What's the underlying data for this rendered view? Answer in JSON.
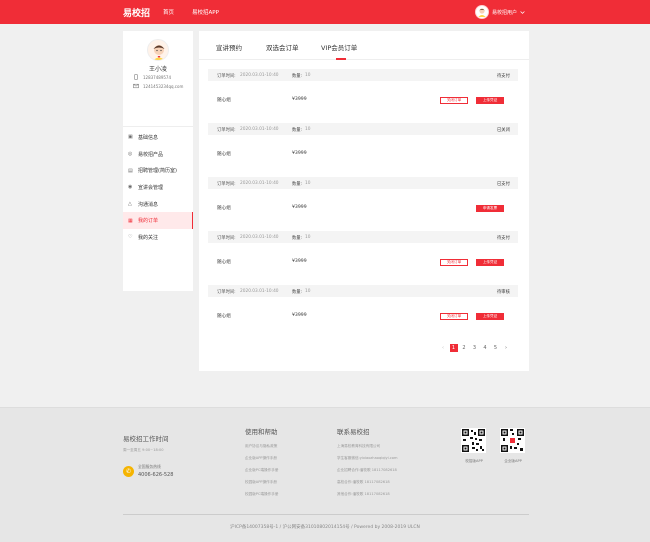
{
  "header": {
    "logo": "易校招",
    "nav": [
      "首页",
      "易校招APP"
    ],
    "user_name": "易校招用户",
    "user_chevron": "chevron-down-icon"
  },
  "colors": {
    "brand": "#f02d37",
    "phone_icon": "#f5b400"
  },
  "profile": {
    "name": "王小凌",
    "phone": "12837489574",
    "email": "1241453234qq.com",
    "phone_icon": "phone-icon",
    "email_icon": "mail-icon"
  },
  "menu": [
    {
      "label": "基础信息",
      "icon": "profile-icon"
    },
    {
      "label": "易校招产品",
      "icon": "product-icon"
    },
    {
      "label": "招聘管理(简历室)",
      "icon": "resume-icon"
    },
    {
      "label": "宣讲会管理",
      "icon": "eye-icon"
    },
    {
      "label": "沟通消息",
      "icon": "bell-icon"
    },
    {
      "label": "我的订单",
      "icon": "order-icon",
      "active": true
    },
    {
      "label": "我的关注",
      "icon": "heart-icon"
    }
  ],
  "tabs": [
    "宣讲预约",
    "双选会订单",
    "VIP会员订单"
  ],
  "active_tab": 2,
  "orders": [
    {
      "time_label": "订单时间:",
      "time": "2020.03.01-10:40",
      "qty_label": "数量:",
      "qty": "10",
      "status": "待支付",
      "product": "随心组",
      "price": "¥3999",
      "buttons": [
        "关闭订单",
        "上传凭证"
      ]
    },
    {
      "time_label": "订单时间:",
      "time": "2020.03.01-10:40",
      "qty_label": "数量:",
      "qty": "10",
      "status": "已关闭",
      "product": "随心组",
      "price": "¥3999",
      "buttons": []
    },
    {
      "time_label": "订单时间:",
      "time": "2020.03.01-10:40",
      "qty_label": "数量:",
      "qty": "10",
      "status": "已支付",
      "product": "随心组",
      "price": "¥3999",
      "buttons": [
        "申请发票"
      ]
    },
    {
      "time_label": "订单时间:",
      "time": "2020.03.01-10:40",
      "qty_label": "数量:",
      "qty": "10",
      "status": "待支付",
      "product": "随心组",
      "price": "¥3999",
      "buttons": [
        "关闭订单",
        "上传凭证"
      ]
    },
    {
      "time_label": "订单时间:",
      "time": "2020.03.01-10:40",
      "qty_label": "数量:",
      "qty": "10",
      "status": "待审核",
      "product": "随心组",
      "price": "¥3999",
      "buttons": [
        "关闭订单",
        "上传凭证"
      ]
    }
  ],
  "pagination": {
    "prev": "‹",
    "pages": [
      "1",
      "2",
      "3",
      "4",
      "5"
    ],
    "current": 1,
    "next": "›"
  },
  "footer": {
    "col1_title": "易校招工作时间",
    "col1_hours": "周一至周五 9:00~18:00",
    "hotline_label": "全国服务热线",
    "hotline": "4006-626-528",
    "col2_title": "使用和帮助",
    "col2_links": [
      "用户协议与隐私政策",
      "企业版APP操作手册",
      "企业版PC端操作手册",
      "校园版APP操作手册",
      "校园版PC端操作手册"
    ],
    "col3_title": "联系易校招",
    "col3_lines": [
      "上海易校教育科技有限公司",
      "学生客服微信:yixiaozhaoqiqiyi.com",
      "企业招聘合作:潘牧歌 18117082618",
      "高校合作:潘牧歌 18117082618",
      "其他合作:潘牧歌 18117082618"
    ],
    "qr1_label": "校招版APP",
    "qr2_label": "企业版APP",
    "copyright": "沪ICP备14007358号-1 / 沪公网安备31010802014154号 / Powered by 2008-2019 ULCN"
  }
}
